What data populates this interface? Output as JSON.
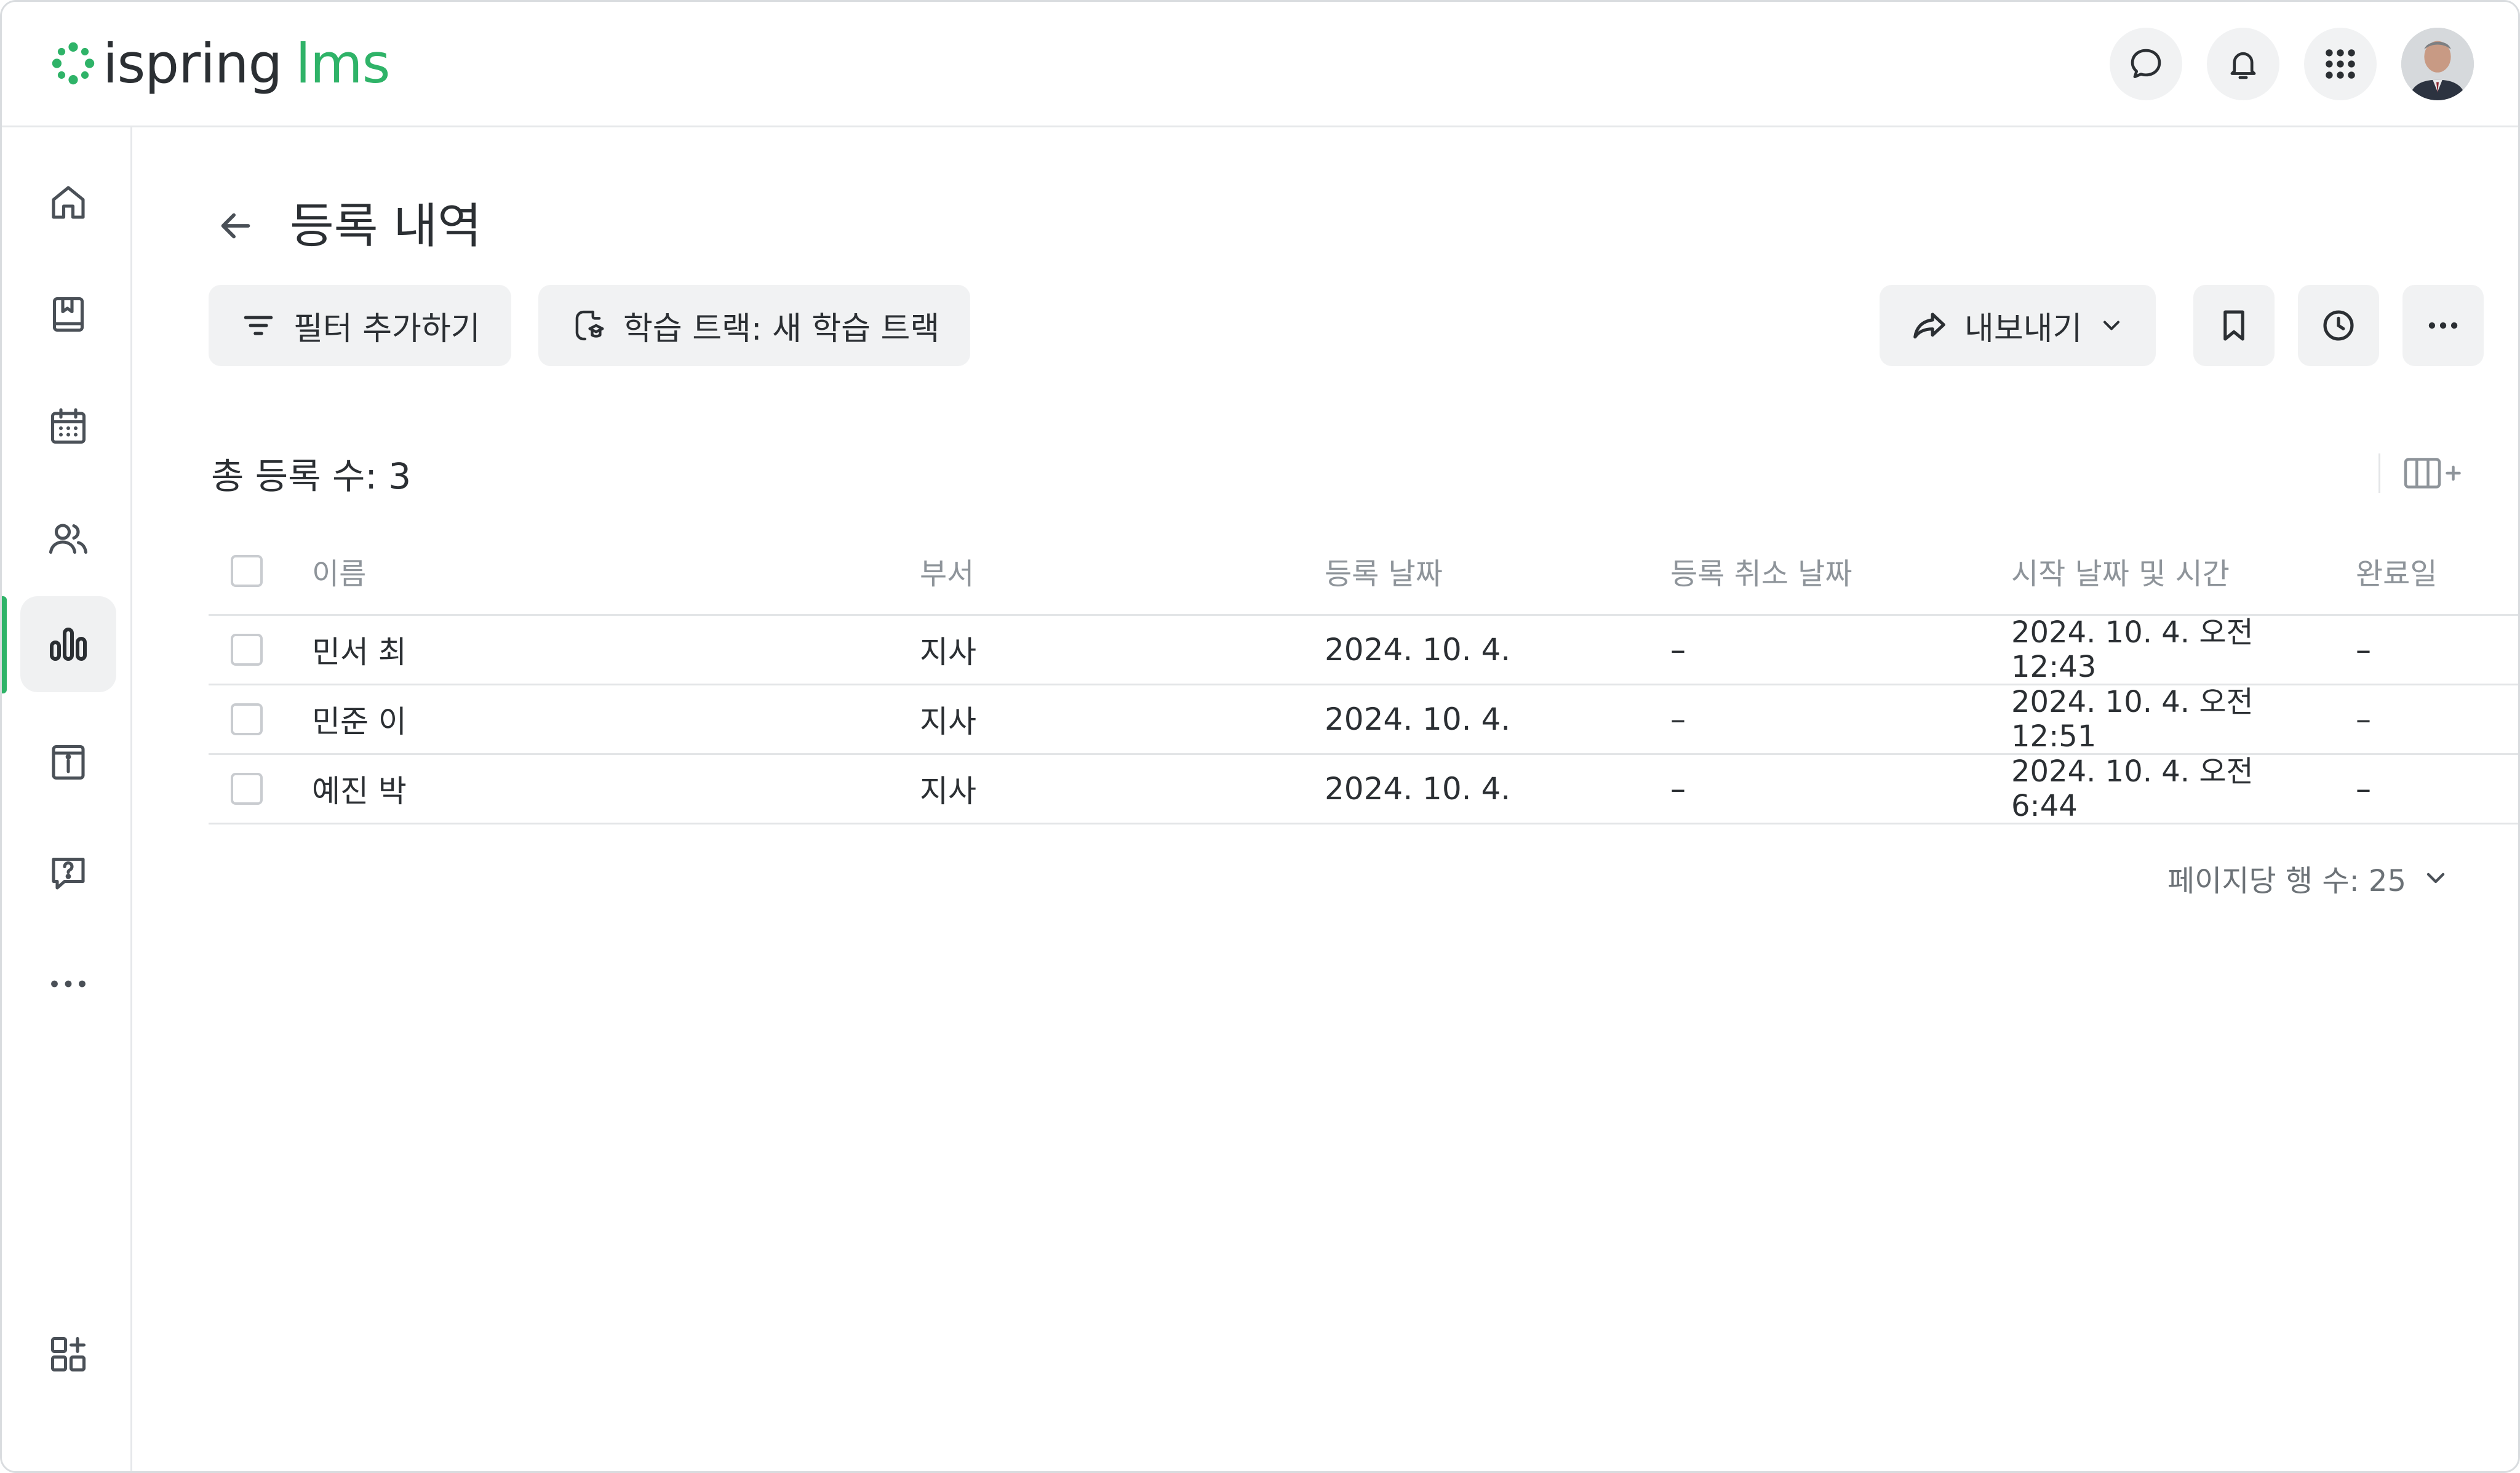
{
  "brand": {
    "name": "ispring",
    "product": "lms",
    "accent": "#2fb368"
  },
  "header": {
    "actions": [
      {
        "name": "chat-icon"
      },
      {
        "name": "bell-icon"
      },
      {
        "name": "apps-grid-icon"
      }
    ]
  },
  "sidebar": {
    "items": [
      {
        "icon": "home-icon"
      },
      {
        "icon": "book-icon"
      },
      {
        "icon": "calendar-icon"
      },
      {
        "icon": "users-icon"
      },
      {
        "icon": "reports-icon",
        "active": true
      },
      {
        "icon": "info-icon"
      },
      {
        "icon": "help-icon"
      },
      {
        "icon": "more-icon"
      },
      {
        "icon": "add-widget-icon"
      }
    ]
  },
  "page": {
    "title": "등록 내역",
    "filter_label": "필터 추가하기",
    "track_label": "학습 트랙: 새 학습 트랙",
    "export_label": "내보내기",
    "total_label": "총 등록 수: 3"
  },
  "table": {
    "columns": [
      "이름",
      "부서",
      "등록 날짜",
      "등록 취소 날짜",
      "시작 날짜 및 시간",
      "완료일"
    ],
    "rows": [
      {
        "name": "민서 최",
        "dept": "지사",
        "enrolled": "2024. 10. 4.",
        "cancelled": "–",
        "start_1": "2024. 10. 4. 오전",
        "start_2": "12:43",
        "completed": "–"
      },
      {
        "name": "민준 이",
        "dept": "지사",
        "enrolled": "2024. 10. 4.",
        "cancelled": "–",
        "start_1": "2024. 10. 4. 오전",
        "start_2": "12:51",
        "completed": "–"
      },
      {
        "name": "예진 박",
        "dept": "지사",
        "enrolled": "2024. 10. 4.",
        "cancelled": "–",
        "start_1": "2024. 10. 4. 오전",
        "start_2": "6:44",
        "completed": "–"
      }
    ]
  },
  "pager": {
    "label": "페이지당 행 수: 25"
  }
}
